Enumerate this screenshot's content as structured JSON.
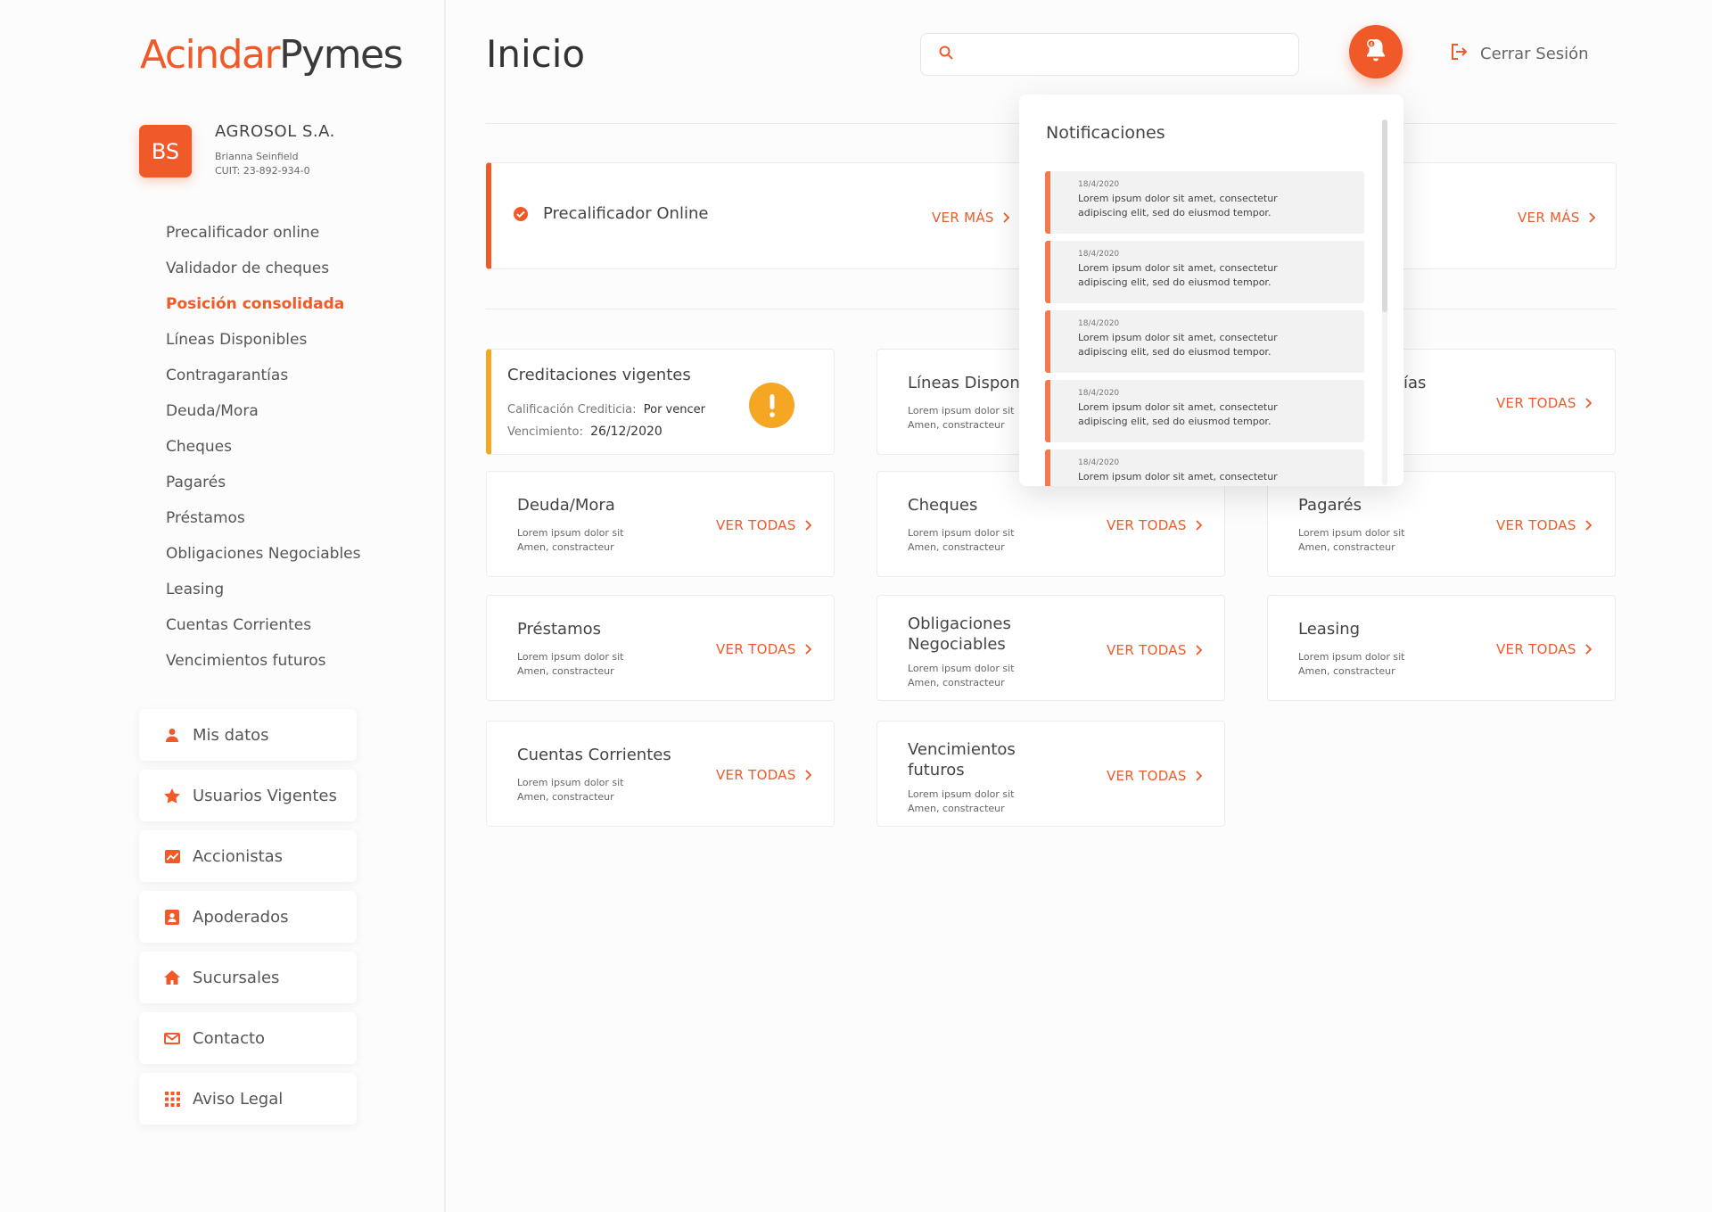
{
  "brand": {
    "part1": "Acindar",
    "part2": "Pymes"
  },
  "profile": {
    "initials": "BS",
    "company": "AGROSOL S.A.",
    "user": "Brianna Seinfield",
    "cuit": "CUIT: 23-892-934-0"
  },
  "menu": [
    {
      "label": "Precalificador online"
    },
    {
      "label": "Validador de cheques"
    },
    {
      "label": "Posición consolidada",
      "active": true
    },
    {
      "label": "Líneas Disponibles"
    },
    {
      "label": "Contragarantías"
    },
    {
      "label": "Deuda/Mora"
    },
    {
      "label": "Cheques"
    },
    {
      "label": "Pagarés"
    },
    {
      "label": "Préstamos"
    },
    {
      "label": "Obligaciones Negociables"
    },
    {
      "label": "Leasing"
    },
    {
      "label": "Cuentas Corrientes"
    },
    {
      "label": "Vencimientos futuros"
    }
  ],
  "boxes": [
    {
      "label": "Mis datos",
      "icon": "person-icon"
    },
    {
      "label": "Usuarios Vigentes",
      "icon": "star-icon"
    },
    {
      "label": "Accionistas",
      "icon": "chart-icon"
    },
    {
      "label": "Apoderados",
      "icon": "id-card-icon"
    },
    {
      "label": "Sucursales",
      "icon": "home-icon"
    },
    {
      "label": "Contacto",
      "icon": "mail-icon"
    },
    {
      "label": "Aviso Legal",
      "icon": "grid-icon"
    }
  ],
  "header": {
    "title": "Inicio",
    "search_placeholder": "",
    "logout": "Cerrar Sesión",
    "bell_badge": "4"
  },
  "precalificador": {
    "title": "Precalificador Online",
    "link": "VER MÁS",
    "link2": "VER MÁS"
  },
  "creditaciones": {
    "title": "Creditaciones vigentes",
    "calif_label": "Calificación Crediticia:",
    "calif_value": "Por vencer",
    "venc_label": "Vencimiento:",
    "venc_value": "26/12/2020"
  },
  "lineas": {
    "title": "Líneas Disponi",
    "sub1": "Lorem ipsum dolor sit",
    "sub2": "Amen, constracteur"
  },
  "contra": {
    "title_tail": "ías",
    "link": "VER TODAS"
  },
  "cards": [
    {
      "title": "Deuda/Mora",
      "sub1": "Lorem ipsum dolor sit",
      "sub2": "Amen, constracteur",
      "link": "VER TODAS"
    },
    {
      "title": "Cheques",
      "sub1": "Lorem ipsum dolor sit",
      "sub2": "Amen, constracteur",
      "link": "VER TODAS"
    },
    {
      "title": "Pagarés",
      "sub1": "Lorem ipsum dolor sit",
      "sub2": "Amen, constracteur",
      "link": "VER TODAS"
    },
    {
      "title": "Préstamos",
      "sub1": "Lorem ipsum dolor sit",
      "sub2": "Amen, constracteur",
      "link": "VER TODAS"
    },
    {
      "title": "Obligaciones",
      "title2": "Negociables",
      "sub1": "Lorem ipsum dolor sit",
      "sub2": "Amen, constracteur",
      "link": "VER TODAS"
    },
    {
      "title": "Leasing",
      "sub1": "Lorem ipsum dolor sit",
      "sub2": "Amen, constracteur",
      "link": "VER TODAS"
    },
    {
      "title": "Cuentas Corrientes",
      "sub1": "Lorem ipsum dolor sit",
      "sub2": "Amen, constracteur",
      "link": "VER TODAS"
    },
    {
      "title": "Vencimientos",
      "title2": "futuros",
      "sub1": "Lorem ipsum dolor sit",
      "sub2": "Amen, constracteur",
      "link": "VER TODAS"
    }
  ],
  "notifications": {
    "title": "Notificaciones",
    "items": [
      {
        "date": "18/4/2020",
        "text": "Lorem ipsum dolor sit amet, consectetur adipiscing elit, sed do eiusmod tempor."
      },
      {
        "date": "18/4/2020",
        "text": "Lorem ipsum dolor sit amet, consectetur adipiscing elit, sed do eiusmod tempor."
      },
      {
        "date": "18/4/2020",
        "text": "Lorem ipsum dolor sit amet, consectetur adipiscing elit, sed do eiusmod tempor."
      },
      {
        "date": "18/4/2020",
        "text": "Lorem ipsum dolor sit amet, consectetur adipiscing elit, sed do eiusmod tempor."
      },
      {
        "date": "18/4/2020",
        "text": "Lorem ipsum dolor sit amet, consectetur"
      }
    ]
  },
  "colors": {
    "accent": "#f05a28",
    "warning": "#f5a623"
  }
}
